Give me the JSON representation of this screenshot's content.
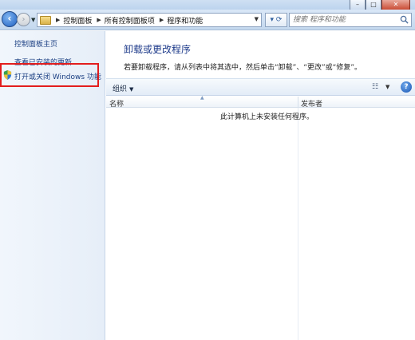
{
  "window": {
    "minimize": "–",
    "maximize": "□",
    "close": "✕"
  },
  "nav": {
    "breadcrumbs": [
      "控制面板",
      "所有控制面板项",
      "程序和功能"
    ],
    "search_placeholder": "搜索 程序和功能"
  },
  "sidebar": {
    "home": "控制面板主页",
    "updates": "查看已安装的更新",
    "features": "打开或关闭 Windows 功能"
  },
  "main": {
    "title": "卸载或更改程序",
    "description": "若要卸载程序，请从列表中将其选中，然后单击“卸载”、“更改”或“修复”。",
    "organize": "组织",
    "columns": {
      "name": "名称",
      "publisher": "发布者"
    },
    "empty_message": "此计算机上未安装任何程序。"
  },
  "colors": {
    "highlight_border": "#e31d1d",
    "link": "#1a3e82",
    "title": "#1d3a8a"
  }
}
